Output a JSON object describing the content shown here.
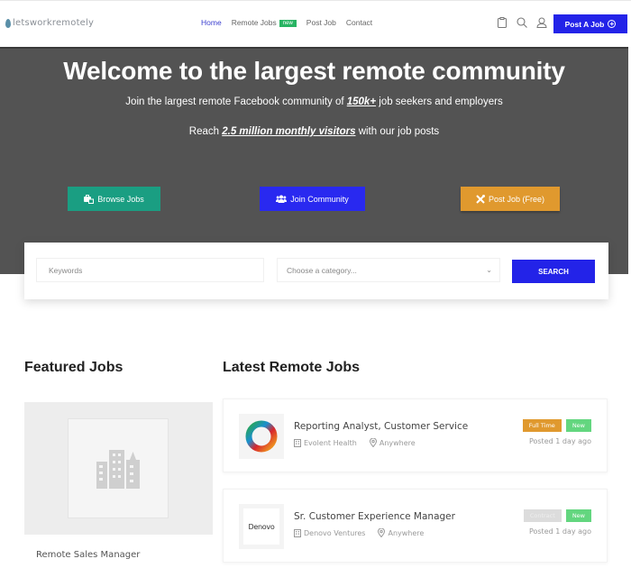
{
  "header": {
    "logo_text": "letsworkremotely",
    "nav": [
      {
        "label": "Home",
        "active": true
      },
      {
        "label": "Remote Jobs",
        "badge": "new"
      },
      {
        "label": "Post Job"
      },
      {
        "label": "Contact"
      }
    ],
    "icons": [
      "clipboard-icon",
      "search-icon",
      "user-icon"
    ],
    "post_button": "Post A Job"
  },
  "hero": {
    "title": "Welcome to the largest remote community",
    "line1_pre": "Join the largest remote Facebook community of ",
    "line1_bold": "150k+",
    "line1_post": " job seekers and employers",
    "line2_pre": "Reach ",
    "line2_bold": "2.5 million monthly visitors",
    "line2_post": " with our job posts",
    "buttons": {
      "browse": "Browse Jobs",
      "join": "Join Community",
      "post_free": "Post Job (Free)"
    },
    "colors": {
      "browse": "#1a9e82",
      "join": "#2929f0",
      "post_free": "#e0992e"
    }
  },
  "search": {
    "keywords_placeholder": "Keywords",
    "keywords_value": "",
    "category_selected": "Choose a category...",
    "button": "SEARCH"
  },
  "featured": {
    "title": "Featured Jobs",
    "jobs": [
      {
        "title": "Remote Sales Manager"
      }
    ]
  },
  "latest": {
    "title": "Latest Remote Jobs",
    "jobs": [
      {
        "title": "Reporting Analyst, Customer Service",
        "company": "Evolent Health",
        "location": "Anywhere",
        "type": "Full Time",
        "badge": "New",
        "posted": "Posted 1 day ago"
      },
      {
        "title": "Sr. Customer Experience Manager",
        "company": "Denovo Ventures",
        "company_logo_text": "Denovo",
        "location": "Anywhere",
        "type": "Contract",
        "badge": "New",
        "posted": "Posted 1 day ago"
      }
    ]
  }
}
